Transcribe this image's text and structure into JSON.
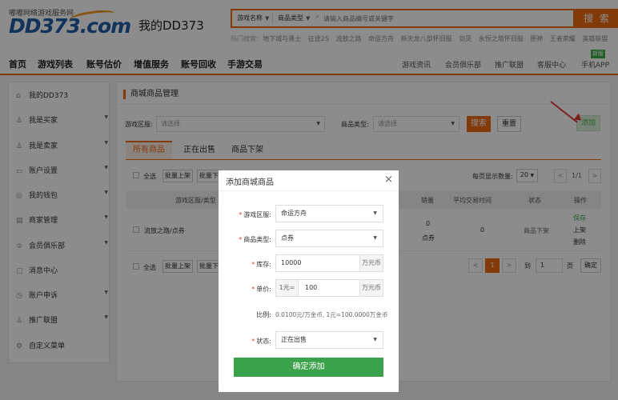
{
  "header": {
    "logo_top": "嘟嘟网络游戏服务网",
    "logo_main": "DD373.com",
    "site_title": "我的DD373",
    "search": {
      "game_name": "游戏名称",
      "product_type": "商品类型",
      "placeholder": "请输入商品编号或关键字",
      "button": "搜 索"
    },
    "hot_label": "热门搜索:",
    "hot_items": [
      "地下城与勇士",
      "征途2S",
      "流放之路",
      "命运方舟",
      "新天龙八部怀旧服",
      "剑灵",
      "永恒之塔怀旧服",
      "原神",
      "王者荣耀",
      "英雄联盟"
    ]
  },
  "nav": {
    "main": [
      "首页",
      "游戏列表",
      "账号估价",
      "增值服务",
      "账号回收",
      "手游交易"
    ],
    "right": [
      "游戏资讯",
      "会员俱乐部",
      "推广联盟",
      "客服中心",
      "手机APP"
    ],
    "new_badge": "新版"
  },
  "sidebar": {
    "items": [
      {
        "label": "我的DD373",
        "icon": "home-icon",
        "arrow": ""
      },
      {
        "label": "我是买家",
        "icon": "user-icon",
        "arrow": "▼"
      },
      {
        "label": "我是卖家",
        "icon": "user-icon",
        "arrow": "▼"
      },
      {
        "label": "账户设置",
        "icon": "id-card-icon",
        "arrow": "▼"
      },
      {
        "label": "我的钱包",
        "icon": "wallet-icon",
        "arrow": "▼"
      },
      {
        "label": "商家管理",
        "icon": "store-icon",
        "arrow": "▼"
      },
      {
        "label": "会员俱乐部",
        "icon": "club-icon",
        "arrow": "▼"
      },
      {
        "label": "消息中心",
        "icon": "message-icon",
        "arrow": ""
      },
      {
        "label": "账户申诉",
        "icon": "appeal-icon",
        "arrow": "▼"
      },
      {
        "label": "推广联盟",
        "icon": "promote-icon",
        "arrow": "▼"
      },
      {
        "label": "自定义菜单",
        "icon": "gear-icon",
        "arrow": ""
      }
    ]
  },
  "main": {
    "title": "商城商品管理",
    "filter": {
      "region_label": "游戏区服:",
      "region_placeholder": "请选择",
      "type_label": "商品类型:",
      "type_placeholder": "请选择",
      "search_btn": "搜索",
      "reset_btn": "重置",
      "add_btn": "添加"
    },
    "tabs": [
      "所有商品",
      "正在出售",
      "商品下架"
    ],
    "toolbar": {
      "select_all": "全选",
      "batch_up": "批量上架",
      "batch_down": "批量下",
      "per_page_label": "每页显示数量:",
      "per_page": "20",
      "page_info": "1/1"
    },
    "table": {
      "headers": [
        "游戏区服/类型",
        "销量",
        "平均交易时间",
        "状态",
        "操作"
      ],
      "row": {
        "name": "流放之路/点券",
        "sales": "0",
        "sales_type": "点券",
        "avg_time": "0",
        "status": "商品下架",
        "actions": [
          "保存",
          "上架",
          "删除"
        ]
      }
    },
    "pager": {
      "current": "1",
      "goto_label": "到",
      "goto_value": "1",
      "unit": "页",
      "confirm": "确定",
      "prev": "<",
      "next": ">"
    }
  },
  "modal": {
    "title": "添加商城商品",
    "close": "×",
    "fields": {
      "region_label": "游戏区服:",
      "region_value": "命运方舟",
      "type_label": "商品类型:",
      "type_value": "点券",
      "stock_label": "库存:",
      "stock_value": "10000",
      "stock_unit": "万元币",
      "price_label": "单价:",
      "price_prefix": "1元=",
      "price_value": "100",
      "price_unit": "万元币",
      "ratio_label": "比例:",
      "ratio_value": "0.0100元/万金币, 1元=100.0000万金币",
      "status_label": "状态:",
      "status_value": "正在出售"
    },
    "confirm": "确定添加"
  }
}
